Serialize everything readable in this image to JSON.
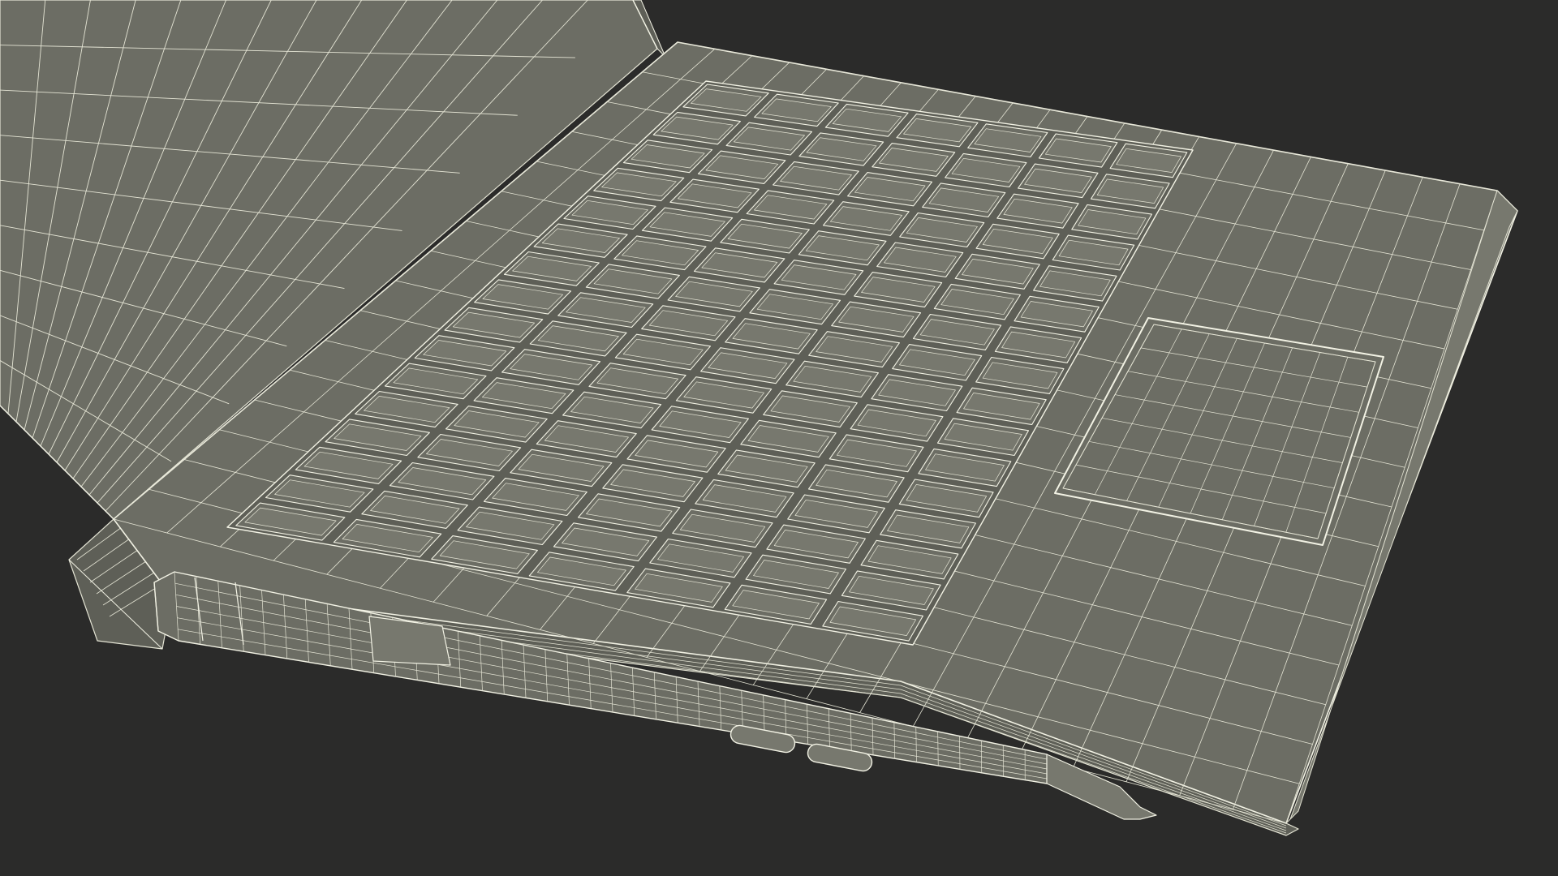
{
  "scene": {
    "subject": "laptop-wireframe-render",
    "colors": {
      "background": "#2b2b2a",
      "surface": "#6c6d64",
      "surface_light": "#77786e",
      "surface_dark": "#5e5f57",
      "wire": "#e4e4d4",
      "edge": "#f2f2e4"
    }
  }
}
